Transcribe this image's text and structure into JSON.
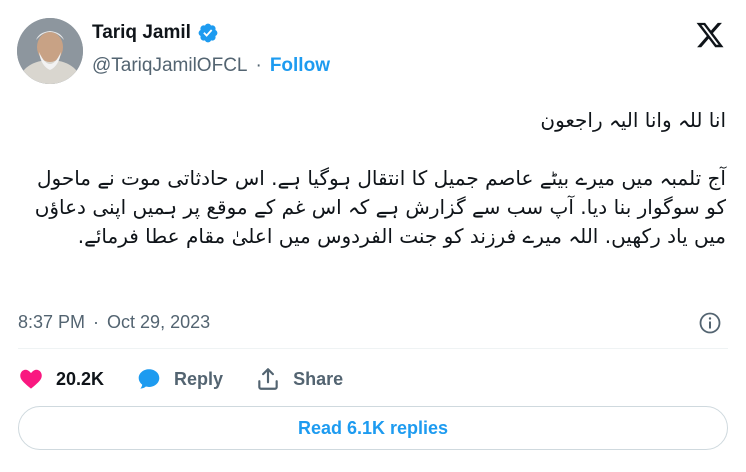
{
  "author": {
    "name": "Tariq Jamil",
    "handle": "@TariqJamilOFCL",
    "separator": "·",
    "follow_label": "Follow"
  },
  "tweet": {
    "line1": "انا للہ وانا الیہ راجعون",
    "body": "آج تلمبہ میں میرے بیٹے عاصم جمیل کا انتقال ہوگیا ہے. اس حادثاتی موت نے ماحول کو سوگوار بنا دیا. آپ سب سے گزارش ہے کہ اس غم کے موقع پر ہمیں اپنی دعاؤں میں یاد رکھیں. اللہ میرے فرزند کو جنت الفردوس میں اعلیٰ مقام عطا فرمائے."
  },
  "meta": {
    "time": "8:37 PM",
    "separator": "·",
    "date": "Oct 29, 2023"
  },
  "actions": {
    "like_count": "20.2K",
    "reply_label": "Reply",
    "share_label": "Share"
  },
  "replies_button": "Read 6.1K replies",
  "colors": {
    "accent": "#1d9bf0",
    "like": "#f91880",
    "text": "#0f1419",
    "muted": "#536471",
    "border": "#cfd9de"
  },
  "icons": {
    "verified": "verified-badge-icon",
    "brand": "x-logo-icon",
    "info": "info-icon",
    "like": "heart-icon",
    "reply": "speech-bubble-icon",
    "share": "upload-icon"
  }
}
